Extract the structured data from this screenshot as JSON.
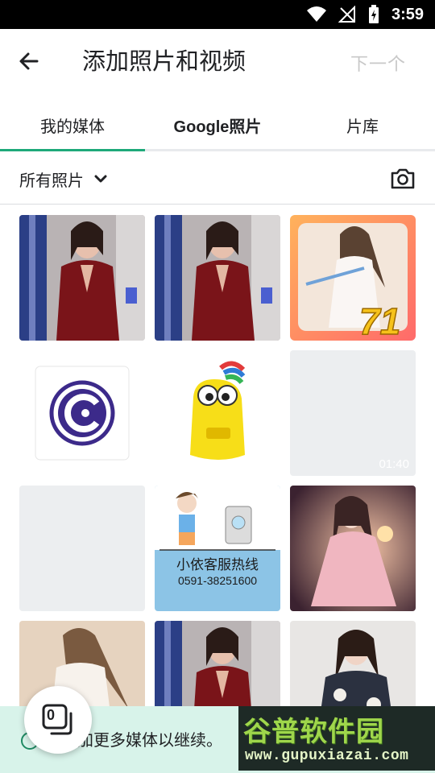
{
  "status_bar": {
    "time": "3:59",
    "icons": [
      "wifi-icon",
      "no-signal-icon",
      "battery-charging-icon"
    ]
  },
  "app_bar": {
    "back_icon": "back-arrow-icon",
    "title": "添加照片和视频",
    "next_label": "下一个"
  },
  "tabs": [
    {
      "label": "我的媒体",
      "selected": true
    },
    {
      "label": "Google照片",
      "selected": false
    },
    {
      "label": "片库",
      "selected": false
    }
  ],
  "filter": {
    "label": "所有照片",
    "dropdown_icon": "chevron-down-icon",
    "camera_icon": "camera-icon"
  },
  "grid": {
    "items": [
      {
        "kind": "photo",
        "subject": "woman in red dress"
      },
      {
        "kind": "photo",
        "subject": "woman in red dress"
      },
      {
        "kind": "photo",
        "subject": "game character with sword",
        "badge": "71"
      },
      {
        "kind": "app-logo",
        "subject": "purple circular logo"
      },
      {
        "kind": "app-logo",
        "subject": "yellow cartoon mascot"
      },
      {
        "kind": "video",
        "duration": "01:40"
      },
      {
        "kind": "blank"
      },
      {
        "kind": "photo",
        "subject": "customer service hotline card",
        "caption_line1": "小依客服热线",
        "caption_line2": "0591-38251600"
      },
      {
        "kind": "photo",
        "subject": "fantasy woman in pink"
      },
      {
        "kind": "photo",
        "subject": "fantasy woman in white"
      },
      {
        "kind": "photo",
        "subject": "woman in red dress"
      },
      {
        "kind": "photo",
        "subject": "woman in floral shirt"
      }
    ]
  },
  "bottom_bar": {
    "text": "加更多媒体以继续。",
    "selected_count": "0"
  },
  "watermark": {
    "title": "谷普软件园",
    "url": "www.gupuxiazai.com"
  },
  "colors": {
    "accent": "#1ea97a",
    "bottom_bg": "#d8f3ea",
    "disabled_text": "#c8c8c8"
  }
}
